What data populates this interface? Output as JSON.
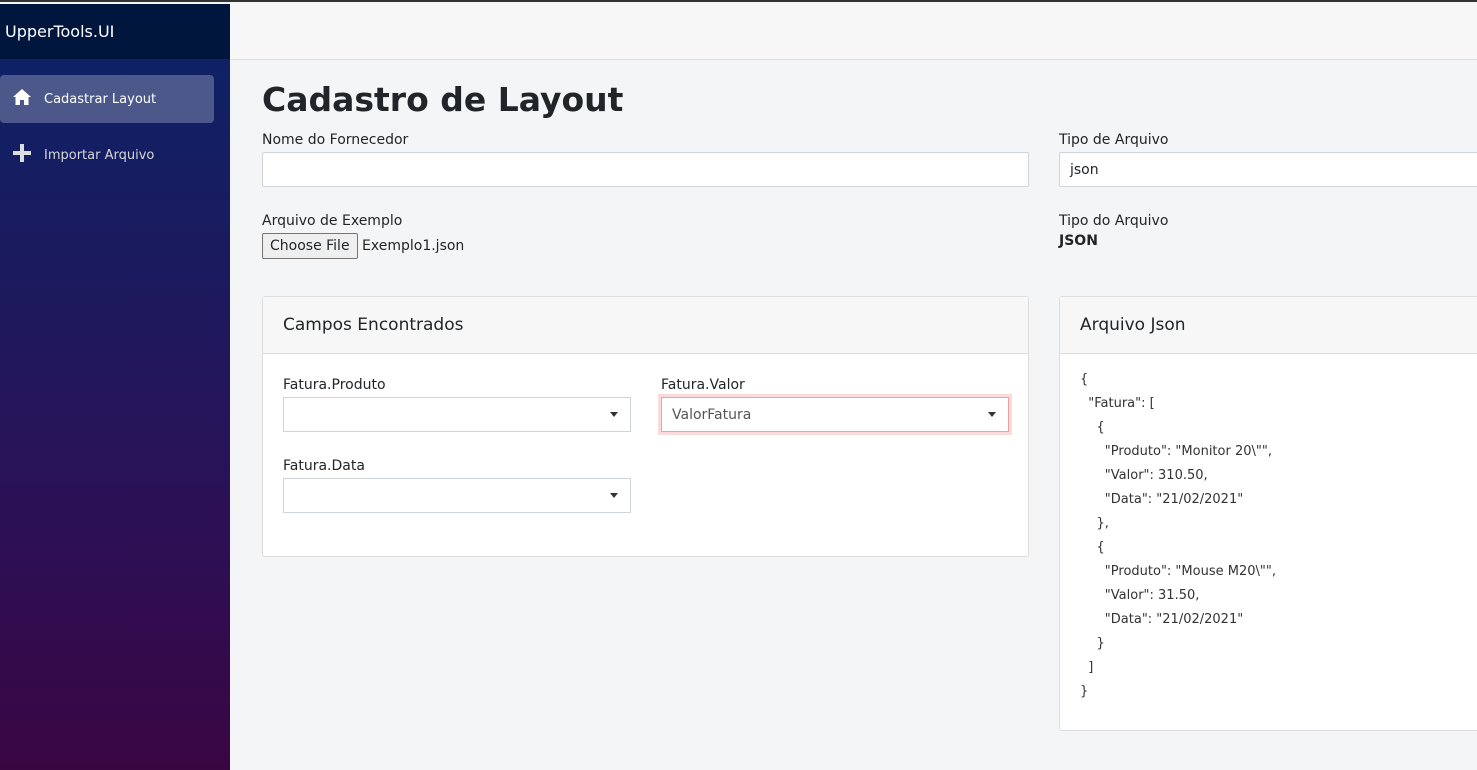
{
  "sidebar": {
    "brand": "UpperTools.UI",
    "items": [
      {
        "label": "Cadastrar Layout",
        "icon": "home-icon"
      },
      {
        "label": "Importar Arquivo",
        "icon": "plus-icon"
      }
    ]
  },
  "page": {
    "title": "Cadastro de Layout"
  },
  "form": {
    "fornecedor_label": "Nome do Fornecedor",
    "fornecedor_value": "",
    "tipo_label": "Tipo de Arquivo",
    "tipo_value": "json",
    "exemplo_label": "Arquivo de Exemplo",
    "choose_file": "Choose File",
    "file_name": "Exemplo1.json",
    "tipo_do_label": "Tipo do Arquivo",
    "tipo_do_value": "JSON"
  },
  "campos": {
    "title": "Campos Encontrados",
    "fields": [
      {
        "label": "Fatura.Produto",
        "value": ""
      },
      {
        "label": "Fatura.Valor",
        "value": "ValorFatura"
      },
      {
        "label": "Fatura.Data",
        "value": ""
      }
    ]
  },
  "json_card": {
    "title": "Arquivo Json",
    "content": "{\n  \"Fatura\": [\n    {\n      \"Produto\": \"Monitor 20\\\"\",\n      \"Valor\": 310.50,\n      \"Data\": \"21/02/2021\"\n    },\n    {\n      \"Produto\": \"Mouse M20\\\"\",\n      \"Valor\": 31.50,\n      \"Data\": \"21/02/2021\"\n    }\n  ]\n}"
  }
}
